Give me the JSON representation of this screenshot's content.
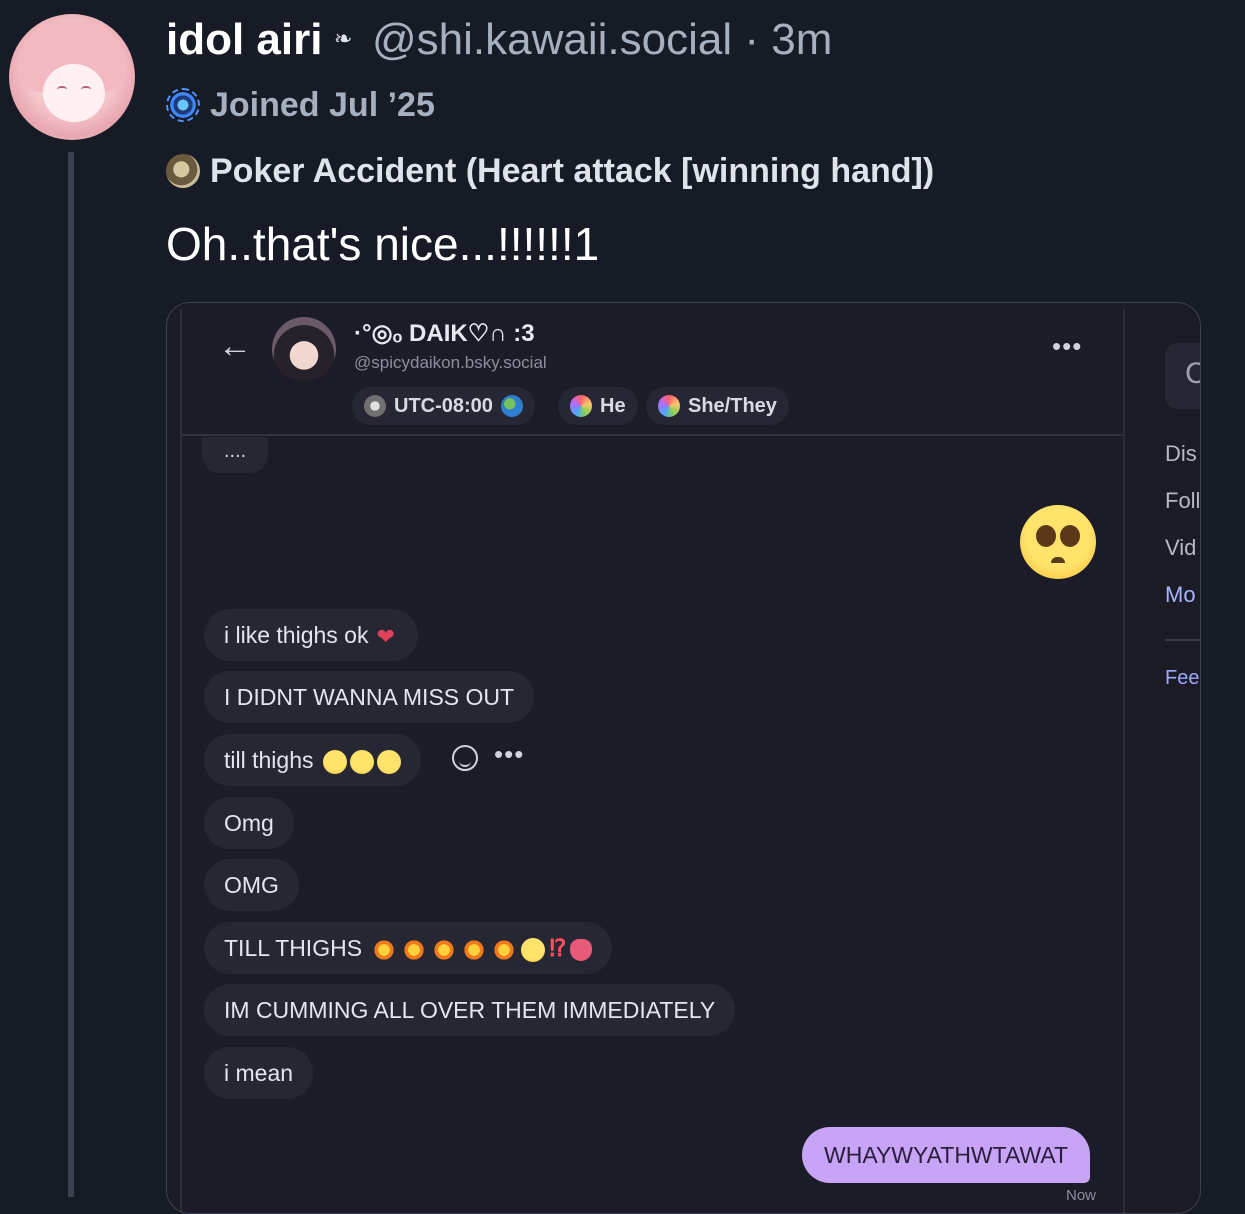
{
  "post": {
    "display_name": "idol airi",
    "name_badge": "❧",
    "handle": "@shi.kawaii.social · 3m",
    "joined": "Joined Jul ’25",
    "status": "Poker Accident (Heart attack [winning hand])",
    "text": "Oh..that's nice...!!!!!!1"
  },
  "embed": {
    "header": {
      "back": "←",
      "name": "·°◎ₒ DAIK♡∩ :3",
      "handle": "@spicydaikon.bsky.social",
      "more": "•••",
      "tags": [
        {
          "label": "UTC-08:00"
        },
        {
          "label": "He"
        },
        {
          "label": "She/They"
        }
      ]
    },
    "messages": {
      "dots": "....",
      "m1": "i like thighs ok",
      "m2": "I DIDNT WANNA MISS OUT",
      "m3": "till thighs",
      "m4": "Omg",
      "m5": "OMG",
      "m6": "TILL THIGHS",
      "m7": "IM CUMMING ALL OVER THEM IMMEDIATELY",
      "m8": "i mean",
      "mine": "WHAYWYATHWTAWAT",
      "time": "Now",
      "react_more": "•••",
      "m6_punct": "⁉"
    },
    "side_panel": {
      "search_glyph": "C",
      "items": [
        "Dis",
        "Foll",
        "Vid",
        "Mo"
      ],
      "feeds": "Fee"
    }
  },
  "colors": {
    "background": "#161b26",
    "my_bubble": "#c7a4f6",
    "other_bubble": "#272734"
  }
}
